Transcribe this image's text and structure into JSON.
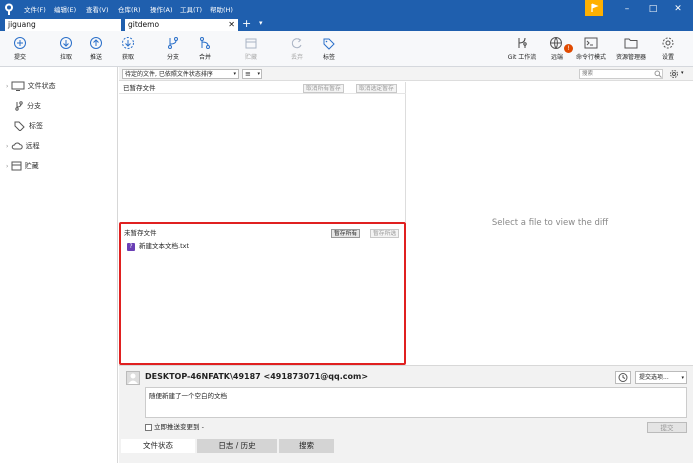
{
  "menu": {
    "items": [
      "文件(F)",
      "编辑(E)",
      "查看(V)",
      "仓库(R)",
      "操作(A)",
      "工具(T)",
      "帮助(H)"
    ]
  },
  "window_controls": {
    "minimize": "–",
    "maximize": "□",
    "close": "✕"
  },
  "tabs": {
    "repo_tab": "jiguang",
    "active_tab": "gitdemo",
    "close": "✕",
    "new_tab": "+",
    "dropdown": "▾"
  },
  "toolbar": {
    "commit": "提交",
    "pull": "拉取",
    "push": "推送",
    "fetch": "获取",
    "branch": "分支",
    "merge": "合并",
    "stash": "贮藏",
    "discard": "丢弃",
    "tag": "标签",
    "git_flow": "Git 工作流",
    "remote": "远端",
    "terminal": "命令行模式",
    "explorer": "资源管理器",
    "settings": "设置"
  },
  "sidebar": {
    "items": [
      {
        "label": "文件状态",
        "icon": "monitor-icon"
      },
      {
        "label": "分支",
        "icon": "branch-icon"
      },
      {
        "label": "标签",
        "icon": "tag-icon"
      },
      {
        "label": "远程",
        "icon": "cloud-icon"
      },
      {
        "label": "贮藏",
        "icon": "stash-icon"
      }
    ]
  },
  "file_filter": {
    "sort_label": "待定的文件, 已依照文件状态排序",
    "view_icon": "≡",
    "search_placeholder": "搜索"
  },
  "staged": {
    "title": "已暂存文件",
    "unstage_all": "取消所有暂存",
    "unstage_selected": "取消选定暂存"
  },
  "unstaged": {
    "title": "未暂存文件",
    "stage_all": "暂存所有",
    "stage_selected": "暂存所选",
    "files": [
      {
        "name": "新建文本文档.txt",
        "status": "?"
      }
    ]
  },
  "diff": {
    "placeholder": "Select a file to view the diff"
  },
  "commit": {
    "author": "DESKTOP-46NFATK\\49187 <491873071@qq.com>",
    "message": "随便新建了一个空白的文档",
    "options_label": "提交选项...",
    "push_immediately": "立即推送变更到 -",
    "submit": "提交"
  },
  "bottom_tabs": [
    "文件状态",
    "日志 / 历史",
    "搜索"
  ],
  "colors": {
    "titlebar": "#1f5fae",
    "accent": "#2a6fc9",
    "highlight_box": "#e02020",
    "warning": "#ffb000",
    "badge": "#e04a00"
  }
}
